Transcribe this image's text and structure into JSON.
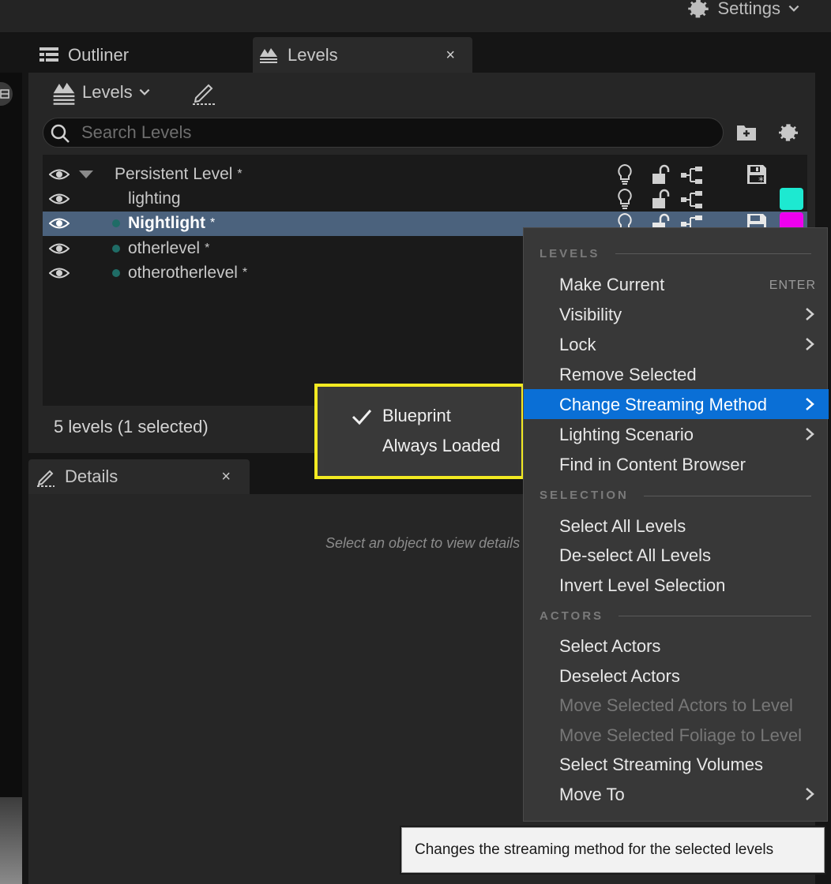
{
  "topbar": {
    "settings_label": "Settings"
  },
  "tabs": {
    "outliner": "Outliner",
    "levels": "Levels",
    "close_glyph": "×"
  },
  "levels_panel": {
    "dropdown_label": "Levels",
    "search_placeholder": "Search Levels",
    "rows": [
      {
        "name": "Persistent Level",
        "modified": "*",
        "color": ""
      },
      {
        "name": "lighting",
        "modified": "",
        "color": "#1de9d1"
      },
      {
        "name": "Nightlight",
        "modified": "*",
        "color": "#ee00ee",
        "selected": true
      },
      {
        "name": "otherlevel",
        "modified": "*",
        "color": ""
      },
      {
        "name": "otherotherlevel",
        "modified": "*",
        "color": ""
      }
    ],
    "status": "5 levels (1 selected)"
  },
  "details": {
    "tab_label": "Details",
    "hint": "Select an object to view details"
  },
  "submenu": {
    "items": [
      "Blueprint",
      "Always Loaded"
    ],
    "checked": "Blueprint"
  },
  "context_menu": {
    "sections": {
      "levels": "LEVELS",
      "selection": "SELECTION",
      "actors": "ACTORS"
    },
    "items": {
      "make_current": "Make Current",
      "make_current_shortcut": "ENTER",
      "visibility": "Visibility",
      "lock": "Lock",
      "remove_selected": "Remove Selected",
      "change_streaming": "Change Streaming Method",
      "lighting_scenario": "Lighting Scenario",
      "find_in_cb": "Find in Content Browser",
      "select_all": "Select All Levels",
      "deselect_all": "De-select All Levels",
      "invert": "Invert Level Selection",
      "select_actors": "Select Actors",
      "deselect_actors": "Deselect Actors",
      "move_actors": "Move Selected Actors to Level",
      "move_foliage": "Move Selected Foliage to Level",
      "select_volumes": "Select Streaming Volumes",
      "move_to": "Move To"
    }
  },
  "tooltip": "Changes the streaming method for the selected levels",
  "colors": {
    "accent": "#0a6fd6",
    "highlight": "#f3ea22",
    "selected_row": "#4b627d"
  }
}
